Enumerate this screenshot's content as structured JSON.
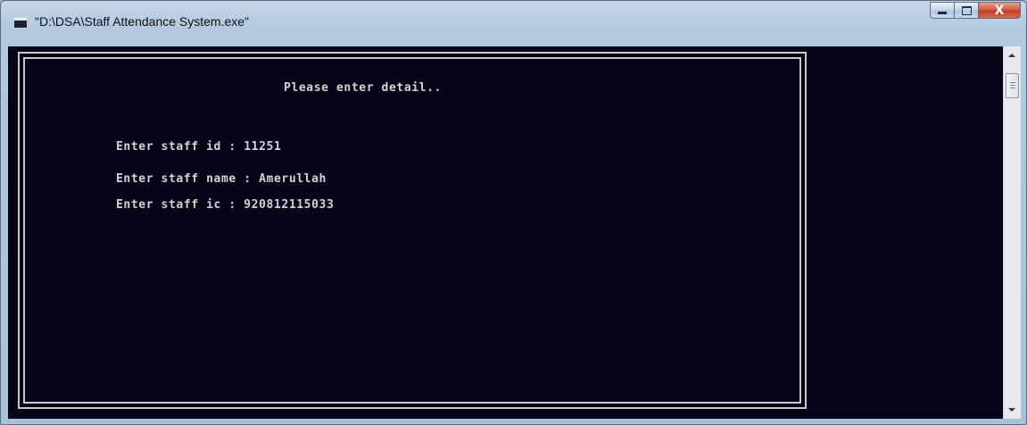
{
  "window": {
    "title": "\"D:\\DSA\\Staff Attendance System.exe\"",
    "icon": "console-app-icon",
    "buttons": {
      "minimize": "minimize-icon",
      "maximize": "maximize-icon",
      "close": "X"
    }
  },
  "console": {
    "heading": "Please enter detail..",
    "lines": [
      "Enter staff id : 11251",
      "Enter staff name : Amerullah",
      "Enter staff ic : 920812115033"
    ],
    "colors": {
      "background": "#050316",
      "text": "#d4d4d4",
      "frame": "#c8c8c8"
    }
  },
  "scrollbar": {
    "up": "scroll-up-arrow",
    "down": "scroll-down-arrow"
  }
}
